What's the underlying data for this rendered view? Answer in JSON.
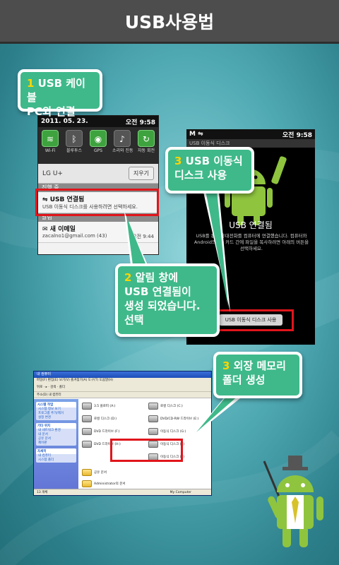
{
  "header": {
    "title": "USB사용법"
  },
  "callout1": {
    "num": "1",
    "line1": " USB 케이블",
    "line2": "PC와 연결"
  },
  "callout2": {
    "num": "2",
    "line1": " 알림 창에",
    "line2": "USB 연결됨이",
    "line3": "생성 되었습니다.",
    "line4": "선택"
  },
  "callout3a": {
    "num": "3",
    "line1": " USB 이동식",
    "line2": "디스크 사용"
  },
  "callout3b": {
    "num": "3",
    "line1": " 외장 메모리",
    "line2": "폴더 생성"
  },
  "phone1": {
    "status_date": "2011. 05. 23.",
    "status_time": "오전 9:58",
    "quick_settings": [
      {
        "icon": "wifi-icon",
        "label": "Wi-Fi",
        "active": true
      },
      {
        "icon": "bluetooth-icon",
        "label": "블루투스",
        "active": false
      },
      {
        "icon": "gps-icon",
        "label": "GPS",
        "active": true
      },
      {
        "icon": "sound-icon",
        "label": "소리와 진동",
        "active": false
      },
      {
        "icon": "rotate-icon",
        "label": "자동 회전",
        "active": true
      }
    ],
    "carrier": "LG U+",
    "clear_button": "지우기",
    "ongoing_label": "진행 중",
    "usb_title": "USB 연결됨",
    "usb_sub": "USB 이동식 디스크를 사용하려면 선택하세요.",
    "alert_label": "알림",
    "mail_title": "새 이메일",
    "mail_sub": "zacalno1@gmail.com (43)",
    "mail_time": "오전 9:44"
  },
  "phone2": {
    "status_time": "오전 9:58",
    "titlebar": "USB 이동식 디스크",
    "title": "USB 연결됨",
    "desc": "USB를 통해 휴대전화를 컴퓨터에 연결했습니다. 컴퓨터와 Android의 SD 카드 간에 파일을 복사하려면 아래의 버튼을 선택하세요.",
    "button": "USB 이동식 디스크 사용"
  },
  "explorer": {
    "title": "내 컴퓨터",
    "menu": "파일(F)  편집(E)  보기(V)  즐겨찾기(A)  도구(T)  도움말(H)",
    "toolbar": "뒤로  ·  ▸  ·  검색  ·  폴더",
    "address": "주소(D)  내 컴퓨터",
    "side_panels": [
      {
        "title": "시스템 작업",
        "items": [
          "시스템 정보 보기",
          "프로그램 추가/제거",
          "설정 변경"
        ]
      },
      {
        "title": "기타 위치",
        "items": [
          "내 네트워크 환경",
          "내 문서",
          "공유 문서",
          "제어판"
        ]
      },
      {
        "title": "자세히",
        "items": [
          "내 컴퓨터",
          "시스템 폴더"
        ]
      }
    ],
    "drives": [
      "3.5 플로피 (A:)",
      "로컬 디스크 (C:)",
      "로컬 디스크 (D:)",
      "DVD/CD-RW 드라이브 (E:)",
      "DVD 드라이브 (F:)",
      "이동식 디스크 (G:)",
      "DVD 드라이브 (H:)",
      "이동식 디스크 (I:)",
      "이동식 디스크 (J:)",
      "공유 문서",
      "Administrator의 문서"
    ],
    "status_left": "13 개체",
    "status_right": "My Computer"
  },
  "colors": {
    "callout": "#3fb98a",
    "highlight": "#e0151b",
    "number": "#ffd400"
  }
}
